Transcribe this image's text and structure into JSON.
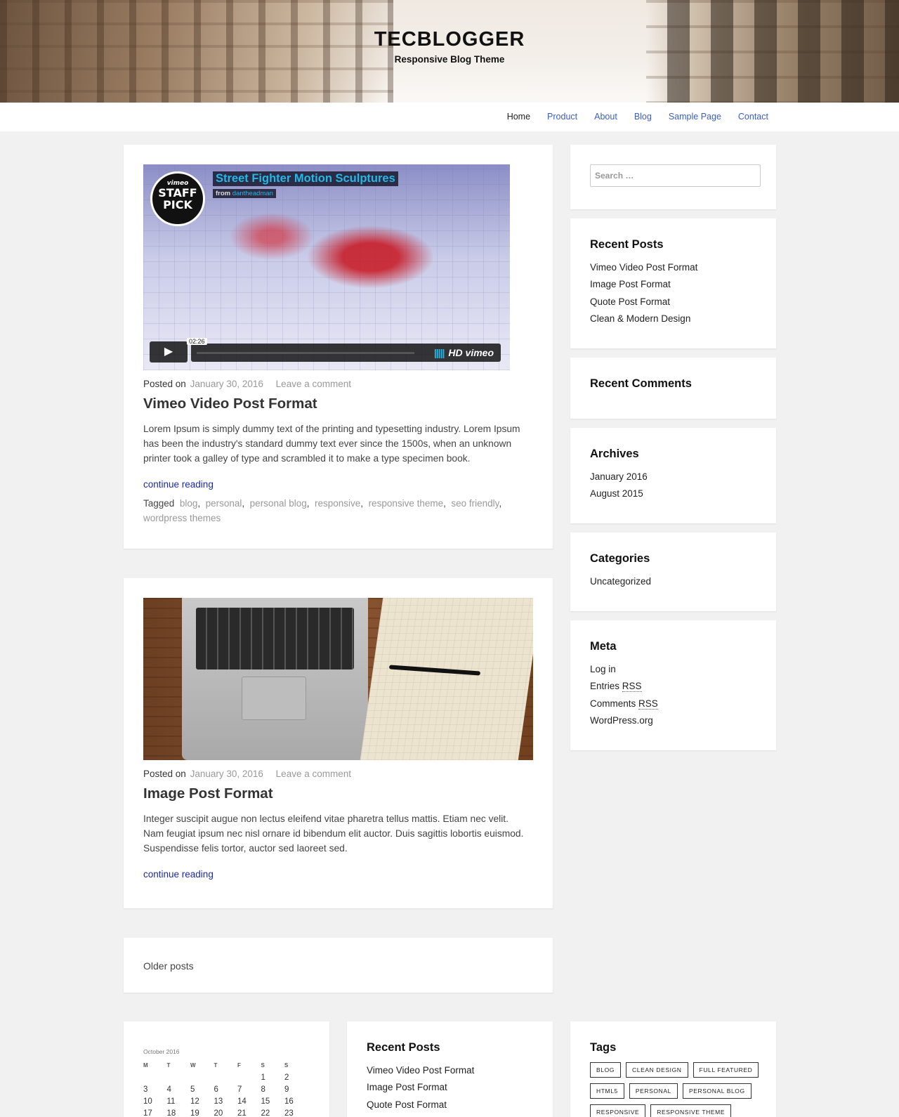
{
  "site": {
    "title": "TECBLOGGER",
    "description": "Responsive Blog Theme"
  },
  "nav": {
    "items": [
      "Home",
      "Product",
      "About",
      "Blog",
      "Sample Page",
      "Contact"
    ],
    "active": "Home"
  },
  "posts": [
    {
      "media": {
        "type": "video",
        "title": "Street Fighter Motion Sculptures",
        "from_label": "from",
        "author": "dantheadman",
        "badge_top": "vimeo",
        "badge_line1": "STAFF",
        "badge_line2": "PICK",
        "duration": "02:26",
        "hd_label": "HD",
        "brand": "vimeo"
      },
      "posted_label": "Posted on",
      "date": "January 30, 2016",
      "comment_link": "Leave a comment",
      "title": "Vimeo Video Post Format",
      "excerpt": "Lorem Ipsum is simply dummy text of the printing and typesetting industry. Lorem Ipsum has been the industry's standard dummy text ever since the 1500s, when an unknown printer took a galley of type and scrambled it to make a type specimen book.",
      "continue": "continue reading",
      "tagged_label": "Tagged",
      "tags": [
        "blog",
        "personal",
        "personal blog",
        "responsive",
        "responsive theme",
        "seo friendly",
        "wordpress themes"
      ]
    },
    {
      "posted_label": "Posted on",
      "date": "January 30, 2016",
      "comment_link": "Leave a comment",
      "title": "Image Post Format",
      "excerpt": "Integer suscipit augue non lectus eleifend vitae pharetra tellus mattis. Etiam nec velit. Nam feugiat ipsum nec nisl ornare id bibendum elit auctor. Duis sagittis lobortis euismod. Suspendisse felis tortor, auctor sed laoreet sed.",
      "continue": "continue reading"
    }
  ],
  "pagination": {
    "older": "Older posts"
  },
  "sidebar": {
    "search_placeholder": "Search …",
    "recent_posts": {
      "title": "Recent Posts",
      "items": [
        "Vimeo Video Post Format",
        "Image Post Format",
        "Quote Post Format",
        "Clean & Modern Design"
      ]
    },
    "recent_comments": {
      "title": "Recent Comments"
    },
    "archives": {
      "title": "Archives",
      "items": [
        "January 2016",
        "August 2015"
      ]
    },
    "categories": {
      "title": "Categories",
      "items": [
        "Uncategorized"
      ]
    },
    "meta": {
      "title": "Meta",
      "login": "Log in",
      "entries": "Entries",
      "comments": "Comments",
      "rss": "RSS",
      "wordpress": "WordPress.org"
    }
  },
  "footer": {
    "calendar": {
      "caption": "October 2016",
      "days": [
        "M",
        "T",
        "W",
        "T",
        "F",
        "S",
        "S"
      ],
      "rows": [
        [
          "",
          "",
          "",
          "",
          "",
          "1",
          "2"
        ],
        [
          "3",
          "4",
          "5",
          "6",
          "7",
          "8",
          "9"
        ],
        [
          "10",
          "11",
          "12",
          "13",
          "14",
          "15",
          "16"
        ],
        [
          "17",
          "18",
          "19",
          "20",
          "21",
          "22",
          "23"
        ]
      ]
    },
    "recent_posts": {
      "title": "Recent Posts",
      "items": [
        "Vimeo Video Post Format",
        "Image Post Format",
        "Quote Post Format"
      ]
    },
    "tags": {
      "title": "Tags",
      "items": [
        "BLOG",
        "CLEAN DESIGN",
        "FULL FEATURED",
        "HTML5",
        "PERSONAL",
        "PERSONAL BLOG",
        "RESPONSIVE",
        "RESPONSIVE THEME"
      ]
    }
  }
}
